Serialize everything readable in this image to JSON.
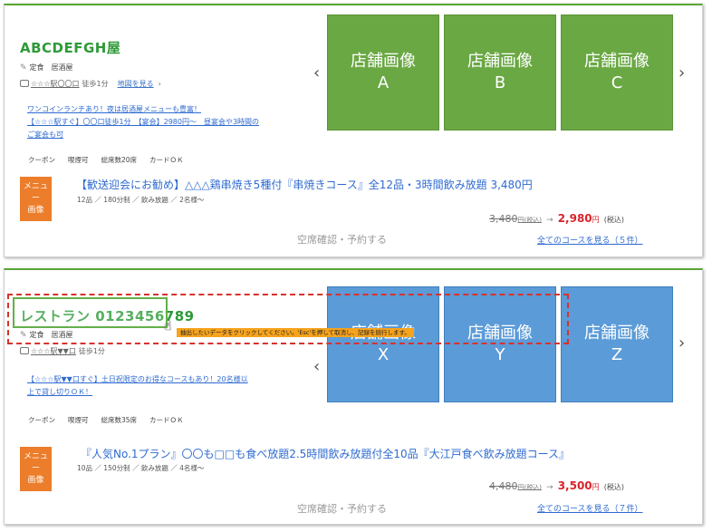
{
  "card1": {
    "name": "ABCDEFGH屋",
    "genre_icon": "tag-icon",
    "genre": "定食　居酒屋",
    "station": "☆☆☆駅〇〇口",
    "walk": "徒歩1分",
    "map_label": "地図を見る",
    "chevron": "›",
    "promo_lines": [
      "ワンコインランチあり！夜は居酒屋メニューも豊富！",
      "【☆☆☆駅すぐ】〇〇口徒歩1分　【宴会】2980円～　昼宴会や3時間の",
      "ご宴会も可"
    ],
    "tags": [
      "クーポン",
      "喫煙可",
      "総席数20席",
      "カードＯＫ"
    ],
    "images": [
      {
        "line1": "店舗画像",
        "line2": "A"
      },
      {
        "line1": "店舗画像",
        "line2": "B"
      },
      {
        "line1": "店舗画像",
        "line2": "C"
      }
    ],
    "menu_img": {
      "line1": "メニュー",
      "line2": "画像"
    },
    "course_title": "【歓送迎会にお勧め】△△△鶏串焼き5種付『串焼きコース』全12品・3時間飲み放題 3,480円",
    "course_meta": "12品 ／ 180分制 ／ 飲み放題 ／ 2名様～",
    "price_old": "3,480",
    "price_old_unit": "円(税込)",
    "price_new": "2,980",
    "price_new_unit": "円",
    "price_tax": "(税込)",
    "reserve": "空席確認・予約する",
    "all_course": "全てのコースを見る（５件）"
  },
  "card2": {
    "name": "レストラン 0123456789",
    "genre": "定食　居酒屋",
    "station": "☆☆☆駅▼▼口",
    "walk": "徒歩1分",
    "map_label": "地図を見る",
    "chevron": "›",
    "promo_lines": [
      "【☆☆☆駅▼▼口すぐ】土日祝限定のお得なコースもあり！20名様以",
      "上で貸し切りＯＫ！"
    ],
    "tags": [
      "クーポン",
      "喫煙可",
      "総席数35席",
      "カードＯＫ"
    ],
    "images": [
      {
        "line1": "店舗画像",
        "line2": "X"
      },
      {
        "line1": "店舗画像",
        "line2": "Y"
      },
      {
        "line1": "店舗画像",
        "line2": "Z"
      }
    ],
    "menu_img": {
      "line1": "メニュー",
      "line2": "画像"
    },
    "course_title": "『人気No.1プラン』〇〇も□□も食べ放題2.5時間飲み放題付全10品『大江戸食べ飲み放題コース』",
    "course_meta": "10品 ／ 150分制 ／ 飲み放題 ／ 4名様～",
    "price_old": "4,480",
    "price_old_unit": "円(税込)",
    "price_new": "3,500",
    "price_new_unit": "円",
    "price_tax": "(税込)",
    "reserve": "空席確認・予約する",
    "all_course": "全てのコースを見る（７件）"
  },
  "overlay": {
    "tooltip": "抽出したいデータをクリックしてください。'Esc'を押して取消し、記録を続行します。",
    "cursor_icon": "hand-pointer-icon"
  },
  "arrows": {
    "left": "‹",
    "right": "›"
  },
  "colors": {
    "brand_green": "#2e9a38",
    "image_green": "#6aa843",
    "image_blue": "#5b9bd8",
    "menu_orange": "#ec7d2a",
    "price_red": "#d8232a",
    "link_blue": "#2f6bd1",
    "tooltip_orange": "#f6a31d",
    "dash_red": "#d9312c"
  }
}
